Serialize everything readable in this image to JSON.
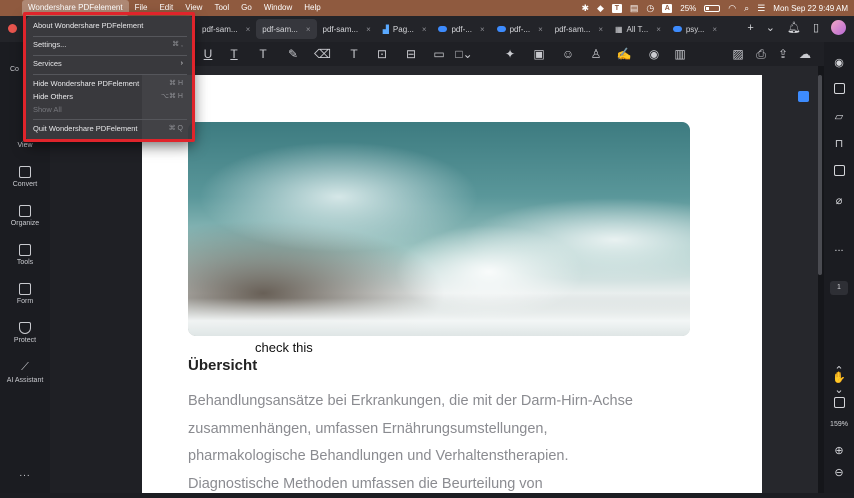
{
  "menubar": {
    "app_name": "Wondershare PDFelement",
    "menus": [
      "File",
      "Edit",
      "View",
      "Tool",
      "Go",
      "Window",
      "Help"
    ],
    "battery": "25%",
    "datetime": "Mon Sep 22  9:49 AM",
    "input_badge": "A"
  },
  "tabs": [
    {
      "label": "pdf-sam...",
      "icon": "none",
      "active": false
    },
    {
      "label": "pdf-sam...",
      "icon": "none",
      "active": true
    },
    {
      "label": "pdf-sam...",
      "icon": "none",
      "active": false
    },
    {
      "label": "Pag...",
      "icon": "chart-icon",
      "active": false
    },
    {
      "label": "pdf-...",
      "icon": "cloud-icon",
      "active": false
    },
    {
      "label": "pdf-...",
      "icon": "cloud-icon",
      "active": false
    },
    {
      "label": "pdf-sam...",
      "icon": "none",
      "active": false
    },
    {
      "label": "All T...",
      "icon": "grid-icon",
      "active": false
    },
    {
      "label": "psy...",
      "icon": "cloud-icon",
      "active": false
    }
  ],
  "leftbar": {
    "top_label_partial": "Co",
    "view_label": "View",
    "items": [
      "Convert",
      "Organize",
      "Tools",
      "Form",
      "Protect",
      "AI Assistant"
    ],
    "more": "..."
  },
  "app_menu": {
    "items": [
      {
        "label": "About Wondershare PDFelement",
        "shortcut": "",
        "disabled": false
      },
      {
        "label": "Settings...",
        "shortcut": "⌘ ,",
        "disabled": false
      },
      {
        "label": "Services",
        "shortcut": "›",
        "disabled": false
      },
      {
        "label": "Hide Wondershare PDFelement",
        "shortcut": "⌘ H",
        "disabled": false
      },
      {
        "label": "Hide Others",
        "shortcut": "⌥⌘ H",
        "disabled": false
      },
      {
        "label": "Show All",
        "shortcut": "",
        "disabled": true
      },
      {
        "label": "Quit Wondershare PDFelement",
        "shortcut": "⌘ Q",
        "disabled": false
      }
    ]
  },
  "document": {
    "annotation": "check this",
    "heading": "Übersicht",
    "paragraph_lines": [
      "Behandlungsansätze bei Erkrankungen, die mit der Darm-Hirn-Achse",
      "zusammenhängen, umfassen Ernährungsumstellungen,",
      "pharmakologische Behandlungen und Verhaltenstherapien.",
      "Diagnostische Methoden umfassen die Beurteilung von"
    ]
  },
  "rightbar": {
    "page_number": "1",
    "zoom": "159%",
    "more": "..."
  },
  "colors": {
    "menubar": "#8f5a3f",
    "highlight_border": "#e0242b",
    "accent": "#3d8bfd"
  }
}
